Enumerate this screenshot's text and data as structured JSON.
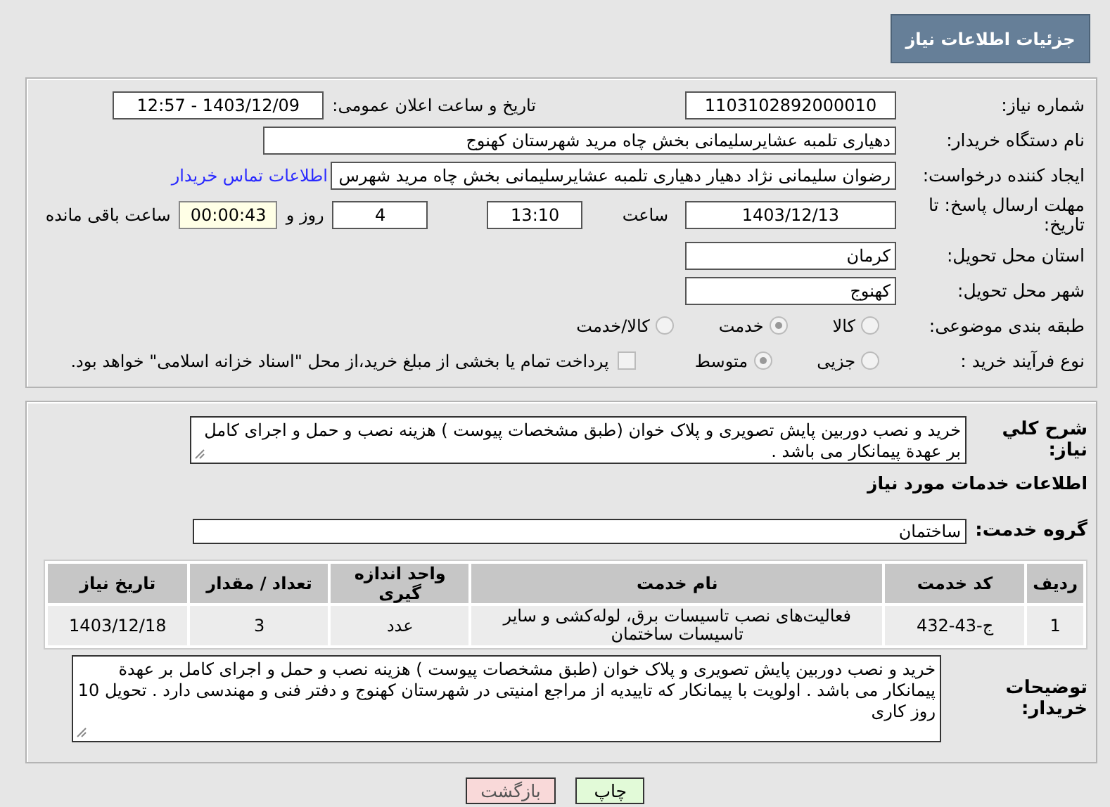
{
  "header": {
    "title": "جزئیات اطلاعات نیاز"
  },
  "need_info": {
    "need_number": {
      "label": "شماره نیاز:",
      "value": "1103102892000010"
    },
    "announce": {
      "label": "تاریخ و ساعت اعلان عمومی:",
      "value": "1403/12/09 - 12:57"
    },
    "buyer_org": {
      "label": "نام دستگاه خریدار:",
      "value": "دهیاری تلمبه عشایرسلیمانی بخش چاه مرید شهرستان کهنوج"
    },
    "requester": {
      "label": "ایجاد کننده درخواست:",
      "value": "رضوان سلیمانی نژاد دهیار دهیاری تلمبه عشایرسلیمانی بخش چاه مرید شهرس",
      "contact_link": "اطلاعات تماس خریدار"
    },
    "deadline": {
      "label": "مهلت ارسال پاسخ: تا تاریخ:",
      "date": "1403/12/13",
      "time_label": "ساعت",
      "time": "13:10",
      "days": "4",
      "days_label": "روز و",
      "remaining": "00:00:43",
      "remaining_label": "ساعت باقی مانده"
    },
    "province": {
      "label": "استان محل تحویل:",
      "value": "کرمان"
    },
    "city": {
      "label": "شهر محل تحویل:",
      "value": "کهنوج"
    },
    "category": {
      "label": "طبقه بندی موضوعی:",
      "options": [
        {
          "label": "کالا",
          "selected": false
        },
        {
          "label": "خدمت",
          "selected": true
        },
        {
          "label": "کالا/خدمت",
          "selected": false
        }
      ]
    },
    "process": {
      "label": "نوع فرآیند خرید :",
      "options": [
        {
          "label": "جزیی",
          "selected": false
        },
        {
          "label": "متوسط",
          "selected": true
        }
      ],
      "payment_note": {
        "checked": false,
        "text": "پرداخت تمام یا بخشی از مبلغ خرید،از محل \"اسناد خزانه اسلامی\" خواهد بود."
      }
    }
  },
  "services": {
    "summary": {
      "label": "شرح کلي نياز:",
      "value": "خرید و نصب دوربین پایش تصویری و پلاک خوان (طبق مشخصات پیوست ) هزینه نصب و حمل و اجرای کامل بر عهدة پیمانکار می باشد ."
    },
    "heading": "اطلاعات خدمات مورد نیاز",
    "group": {
      "label": "گروه خدمت:",
      "value": "ساختمان"
    },
    "table": {
      "columns": [
        "ردیف",
        "کد خدمت",
        "نام خدمت",
        "واحد اندازه گیری",
        "تعداد / مقدار",
        "تاریخ نیاز"
      ],
      "rows": [
        [
          "1",
          "ج-43-432",
          "فعالیت‌های نصب تاسیسات برق، لوله‌کشی و سایر تاسیسات ساختمان",
          "عدد",
          "3",
          "1403/12/18"
        ]
      ]
    },
    "buyer_notes": {
      "label": "توضیحات خریدار:",
      "value": "خرید و نصب دوربین پایش تصویری و پلاک خوان (طبق مشخصات پیوست ) هزینه نصب و حمل و اجرای کامل بر عهدة پیمانکار می باشد . اولویت با پیمانکار که تاییدیه از مراجع امنیتی در شهرستان کهنوج و دفتر فنی و مهندسی دارد . تحویل 10 روز کاری"
    }
  },
  "buttons": [
    {
      "label": "چاپ",
      "kind": "print"
    },
    {
      "label": "بازگشت",
      "kind": "back"
    }
  ]
}
